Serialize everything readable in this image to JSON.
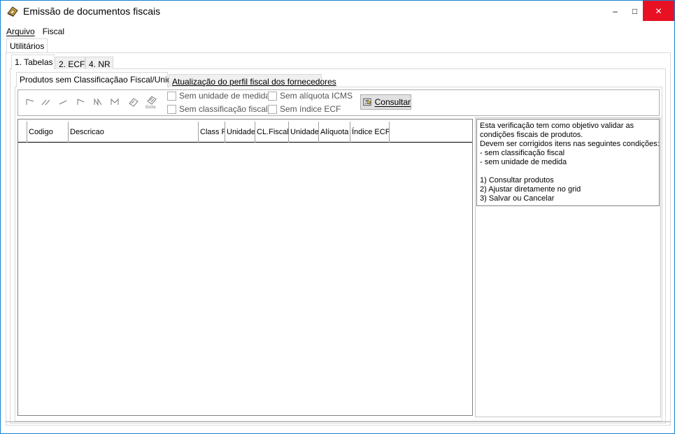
{
  "window": {
    "title": "Emissão de documentos fiscais",
    "controls": {
      "minimize": "–",
      "maximize": "□",
      "close": "✕"
    }
  },
  "menu": [
    {
      "label": "Arquivo"
    },
    {
      "label": "Fiscal"
    }
  ],
  "top_tabs": [
    {
      "label": "Utilitários",
      "active": true
    }
  ],
  "sub_tabs": [
    {
      "label": "1. Tabelas",
      "active": true
    },
    {
      "label": "2. ECF",
      "active": false
    },
    {
      "label": "4. NR",
      "active": false
    }
  ],
  "inner_tabs": [
    {
      "label": "Produtos sem Classificaçãao Fiscal/Unidade",
      "active": true
    },
    {
      "label": "Atualização do perfil fiscal dos fornecedores",
      "active": false
    }
  ],
  "toolbar": {
    "nav_icons": [
      "first-record-icon",
      "prior-page-icon",
      "prior-record-icon",
      "next-record-icon",
      "next-page-icon",
      "last-record-icon",
      "bookmark-icon",
      "goto-bookmark-icon"
    ],
    "goto_label": "Goto",
    "checkboxes": [
      {
        "label": "Sem unidade de medida",
        "checked": false
      },
      {
        "label": "Sem classificação fiscal",
        "checked": false
      },
      {
        "label": "Sem alíquota ICMS",
        "checked": false
      },
      {
        "label": "Sem índice ECF",
        "checked": false
      }
    ],
    "consult_label": "Consultar"
  },
  "grid": {
    "columns": [
      "Codigo",
      "Descricao",
      "Class F",
      "Unidade",
      "CL.Fiscal",
      "Unidade",
      "Alíquota",
      "Índice ECF"
    ],
    "rows": []
  },
  "info": {
    "lines": [
      "Esta verificação tem como objetivo validar as",
      "condições fiscais de produtos.",
      "Devem ser corrigidos itens nas seguintes condições:",
      "- sem classificação fiscal",
      "- sem unidade de medida",
      "",
      "1) Consultar produtos",
      "2) Ajustar diretamente no grid",
      "3) Salvar ou Cancelar"
    ]
  }
}
